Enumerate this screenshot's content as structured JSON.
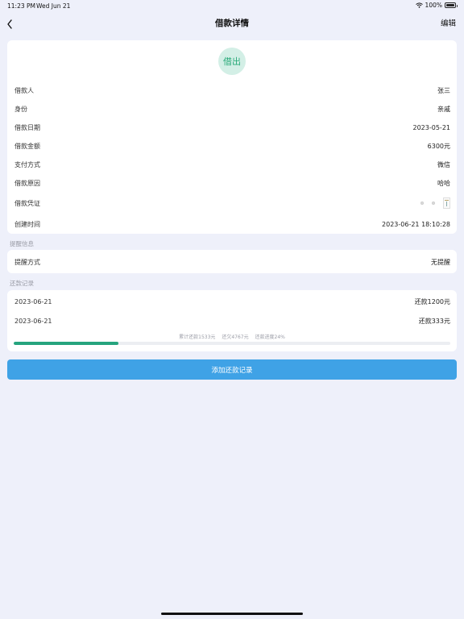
{
  "status_bar": {
    "time": "11:23 PM",
    "date": "Wed Jun 21",
    "battery": "100%",
    "battery_level": 1.0
  },
  "nav": {
    "title": "借款详情",
    "edit_label": "编辑",
    "back_icon": "chevron-left-icon"
  },
  "detail": {
    "badge": "借出",
    "badge_color": "#27a978",
    "rows": [
      {
        "label": "借款人",
        "value": "张三"
      },
      {
        "label": "身份",
        "value": "亲戚"
      },
      {
        "label": "借款日期",
        "value": "2023-05-21"
      },
      {
        "label": "借款金额",
        "value": "6300元"
      },
      {
        "label": "支付方式",
        "value": "微信"
      },
      {
        "label": "借款原因",
        "value": "哈哈"
      },
      {
        "label": "借款凭证",
        "value": ""
      },
      {
        "label": "创建时间",
        "value": "2023-06-21 18:10:28"
      }
    ]
  },
  "reminder": {
    "section_title": "提醒信息",
    "label": "提醒方式",
    "value": "无提醒"
  },
  "records": {
    "section_title": "还款记录",
    "items": [
      {
        "date": "2023-06-21",
        "amount": "还款1200元"
      },
      {
        "date": "2023-06-21",
        "amount": "还款333元"
      }
    ],
    "summary_total": "累计还款1533元",
    "summary_owed": "还欠4767元",
    "summary_progress": "还款进度24%",
    "progress_fraction": 0.24,
    "progress_color": "#26a47e"
  },
  "add_button_label": "添加还款记录"
}
